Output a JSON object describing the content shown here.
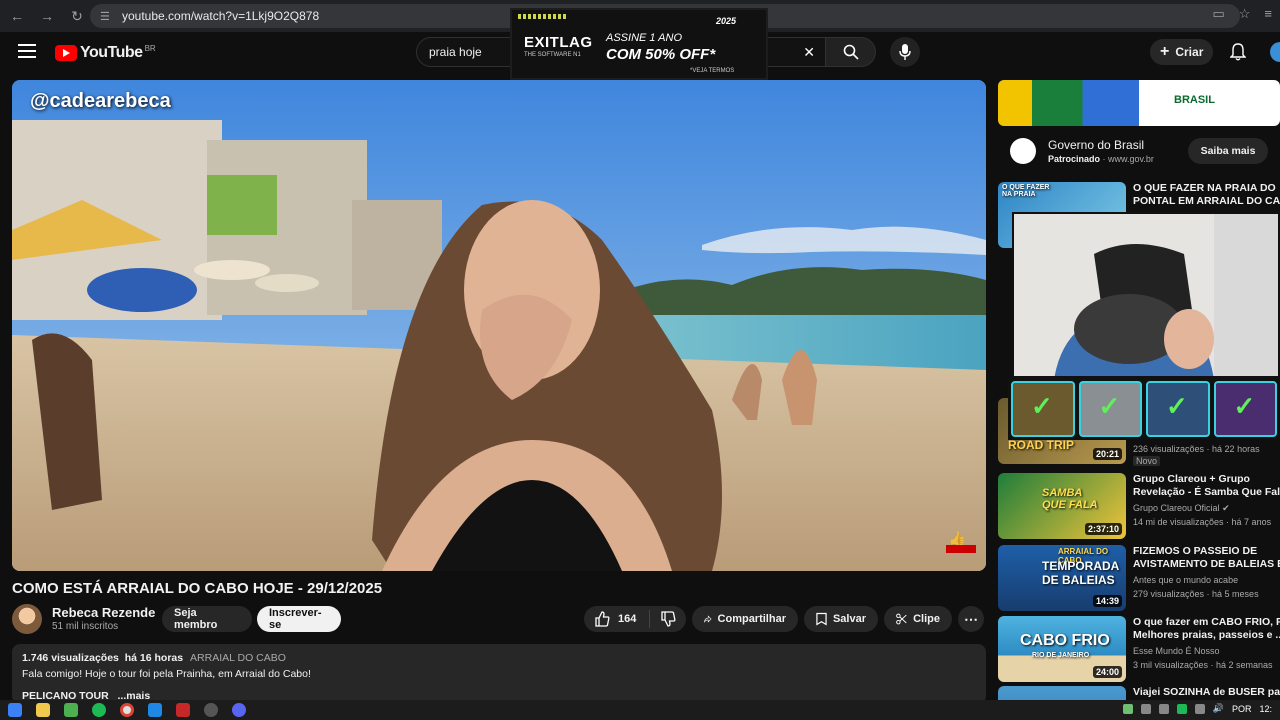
{
  "browser": {
    "url": "youtube.com/watch?v=1Lkj9O2Q878"
  },
  "header": {
    "logo_text": "YouTube",
    "logo_country": "BR",
    "search_value": "praia hoje",
    "create_label": "Criar"
  },
  "ad_banner": {
    "brand": "EXITLAG",
    "brand_sub": "THE SOFTWARE N1",
    "line1": "ASSINE 1 ANO",
    "line2": "COM 50% OFF*",
    "terms": "*VEJA TERMOS",
    "year": "2025"
  },
  "player": {
    "overlay_handle": "@cadearebeca"
  },
  "video": {
    "title": "COMO ESTÁ ARRAIAL DO CABO HOJE - 29/12/2025",
    "channel": "Rebeca Rezende",
    "subscribers": "51 mil inscritos",
    "member_label": "Seja membro",
    "subscribe_label": "Inscrever-se",
    "likes": "164",
    "share_label": "Compartilhar",
    "save_label": "Salvar",
    "clip_label": "Clipe"
  },
  "description": {
    "views": "1.746 visualizações",
    "time": "há 16 horas",
    "tag": "ARRAIAL DO CABO",
    "text": "Fala comigo! Hoje o tour foi pela Prainha, em Arraial do Cabo!",
    "partial": "PELICANO TOUR",
    "more": "...mais"
  },
  "sidebar": {
    "ad": {
      "image_text": "BRASIL",
      "title": "Governo do Brasil",
      "sponsored": "Patrocinado",
      "domain": "www.gov.br",
      "cta": "Saiba mais"
    },
    "recommendations": [
      {
        "title_line1": "O QUE FAZER NA PRAIA DO",
        "title_line2": "PONTAL EM ARRAIAL DO CAB",
        "thumb_text": "O QUE FAZER NA PRAIA",
        "channel": "",
        "stats": "",
        "duration": ""
      },
      {
        "title_line1": "",
        "title_line2": "",
        "thumb_text": "ROAD TRIP",
        "channel": "",
        "stats": "236 visualizações · há 22 horas",
        "badge": "Novo",
        "duration": "20:21"
      },
      {
        "title_line1": "Grupo Clareou + Grupo",
        "title_line2": "Revelação - É Samba Que Fala",
        "thumb_text": "SAMBA QUE FALA",
        "channel": "Grupo Clareou Oficial",
        "stats": "14 mi de visualizações · há 7 anos",
        "duration": "2:37:10"
      },
      {
        "title_line1": "FIZEMOS O PASSEIO DE",
        "title_line2": "AVISTAMENTO DE BALEIAS E...",
        "thumb_text": "TEMPORADA DE BALEIAS",
        "thumb_top": "ARRAIAL DO CABO",
        "channel": "Antes que o mundo acabe",
        "stats": "279 visualizações · há 5 meses",
        "duration": "14:39"
      },
      {
        "title_line1": "O que fazer em CABO FRIO, RJ",
        "title_line2": "Melhores praias, passeios e ...",
        "thumb_text": "CABO FRIO",
        "thumb_sub": "RIO DE JANEIRO",
        "channel": "Esse Mundo É Nosso",
        "stats": "3 mil visualizações · há 2 semanas",
        "duration": "24:00"
      },
      {
        "title_line1": "Viajei SOZINHA de BUSER para",
        "title_line2": "",
        "thumb_text": "",
        "channel": "",
        "stats": "",
        "duration": ""
      }
    ]
  },
  "taskbar": {
    "lang": "POR",
    "clock": "12:"
  },
  "colors": {
    "brand_red": "#ff0000",
    "bg": "#0f0f0f",
    "pill": "#272727"
  }
}
